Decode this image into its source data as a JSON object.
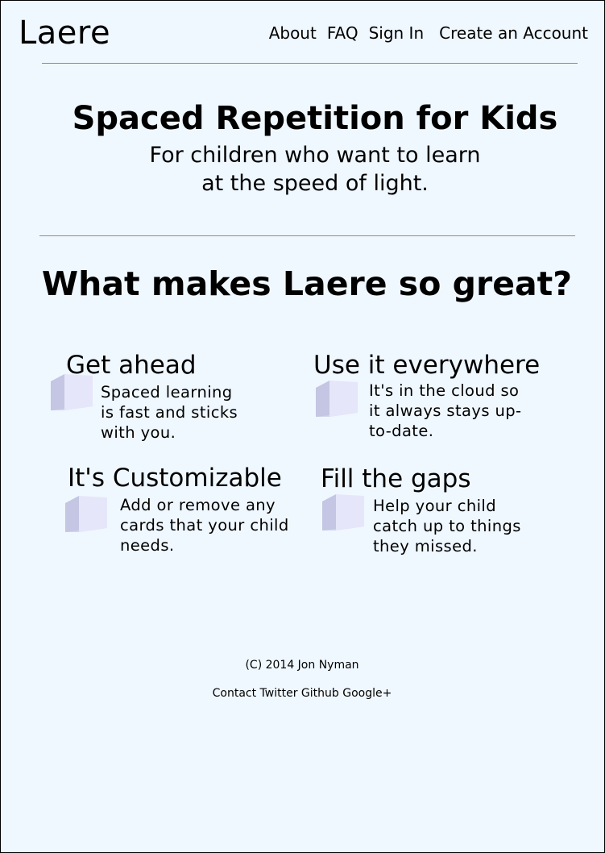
{
  "brand": "Laere",
  "nav": {
    "about": "About",
    "faq": "FAQ",
    "sign_in": "Sign In",
    "create_account": "Create an Account"
  },
  "hero": {
    "title": "Spaced Repetition for Kids",
    "subtitle_line1": "For children who want to learn",
    "subtitle_line2": "at the speed of light."
  },
  "features_heading": "What makes Laere so great?",
  "features": [
    {
      "title": "Get ahead",
      "lines": [
        "Spaced learning",
        "is fast and sticks",
        "with you."
      ],
      "icon": "cube-icon"
    },
    {
      "title": "Use it everywhere",
      "lines": [
        "It's in the cloud so",
        "it always stays up-",
        "to-date."
      ],
      "icon": "cube-icon"
    },
    {
      "title": "It's Customizable",
      "lines": [
        "Add or remove any",
        "cards that your child",
        "needs."
      ],
      "icon": "cube-icon"
    },
    {
      "title": "Fill the gaps",
      "lines": [
        "Help your child",
        "catch up to things",
        "they missed."
      ],
      "icon": "cube-icon"
    }
  ],
  "footer": {
    "copyright": "(C) 2014 Jon Nyman",
    "links": [
      "Contact",
      "Twitter",
      "Github",
      "Google+"
    ]
  },
  "colors": {
    "page_background": "#f0f8ff",
    "divider": "#8c8c8c",
    "cube_front": "#e6e6fa",
    "cube_side": "#c4c6e4",
    "cube_bottom": "#d4d6ee"
  }
}
